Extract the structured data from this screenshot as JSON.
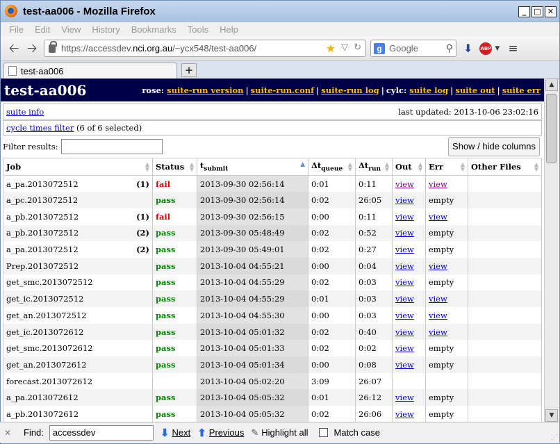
{
  "window": {
    "title": "test-aa006 - Mozilla Firefox",
    "controls": {
      "minimize": "_",
      "maximize": "□",
      "close": "✕"
    }
  },
  "menu": [
    "File",
    "Edit",
    "View",
    "History",
    "Bookmarks",
    "Tools",
    "Help"
  ],
  "nav": {
    "url_prefix": "https://accessdev.",
    "url_host": "nci.org.au",
    "url_path": "/~ycx548/test-aa006/",
    "search_placeholder": "Google",
    "search_engine_icon": "google-g-icon"
  },
  "tab": {
    "title": "test-aa006",
    "new_tab": "+"
  },
  "page": {
    "title": "test-aa006",
    "rose_label": "rose:",
    "rose_links": [
      "suite-run version",
      "suite-run.conf",
      "suite-run log"
    ],
    "cylc_label": "cylc:",
    "cylc_links": [
      "suite log",
      "suite out",
      "suite err"
    ],
    "suite_info": "suite info",
    "last_updated": "last updated: 2013-10-06 23:02:16",
    "cycle_filter_link": "cycle times filter",
    "cycle_filter_count": "(6 of 6 selected)",
    "filter_label": "Filter results:",
    "filter_value": "",
    "show_hide_button": "Show / hide columns"
  },
  "table": {
    "headers": {
      "job": "Job",
      "status": "Status",
      "tsubmit_main": "t",
      "tsubmit_sub": "submit",
      "tqueue_main": "Δt",
      "tqueue_sub": "queue",
      "trun_main": "Δt",
      "trun_sub": "run",
      "out": "Out",
      "err": "Err",
      "other": "Other Files"
    },
    "rows": [
      {
        "job": "a_pa.2013072512",
        "tries": "(1)",
        "status": "fail",
        "tsubmit": "2013-09-30 02:56:14",
        "tqueue": "0:01",
        "trun": "0:11",
        "out": "view",
        "err": "view",
        "visited": true
      },
      {
        "job": "a_pc.2013072512",
        "tries": "",
        "status": "pass",
        "tsubmit": "2013-09-30 02:56:14",
        "tqueue": "0:02",
        "trun": "26:05",
        "out": "view",
        "err": "empty"
      },
      {
        "job": "a_pb.2013072512",
        "tries": "(1)",
        "status": "fail",
        "tsubmit": "2013-09-30 02:56:15",
        "tqueue": "0:00",
        "trun": "0:11",
        "out": "view",
        "err": "view"
      },
      {
        "job": "a_pb.2013072512",
        "tries": "(2)",
        "status": "pass",
        "tsubmit": "2013-09-30 05:48:49",
        "tqueue": "0:02",
        "trun": "0:52",
        "out": "view",
        "err": "empty"
      },
      {
        "job": "a_pa.2013072512",
        "tries": "(2)",
        "status": "pass",
        "tsubmit": "2013-09-30 05:49:01",
        "tqueue": "0:02",
        "trun": "0:27",
        "out": "view",
        "err": "empty"
      },
      {
        "job": "Prep.2013072512",
        "tries": "",
        "status": "pass",
        "tsubmit": "2013-10-04 04:55:21",
        "tqueue": "0:00",
        "trun": "0:04",
        "out": "view",
        "err": "view"
      },
      {
        "job": "get_smc.2013072512",
        "tries": "",
        "status": "pass",
        "tsubmit": "2013-10-04 04:55:29",
        "tqueue": "0:02",
        "trun": "0:03",
        "out": "view",
        "err": "empty"
      },
      {
        "job": "get_ic.2013072512",
        "tries": "",
        "status": "pass",
        "tsubmit": "2013-10-04 04:55:29",
        "tqueue": "0:01",
        "trun": "0:03",
        "out": "view",
        "err": "view"
      },
      {
        "job": "get_an.2013072512",
        "tries": "",
        "status": "pass",
        "tsubmit": "2013-10-04 04:55:30",
        "tqueue": "0:00",
        "trun": "0:03",
        "out": "view",
        "err": "view"
      },
      {
        "job": "get_ic.2013072612",
        "tries": "",
        "status": "pass",
        "tsubmit": "2013-10-04 05:01:32",
        "tqueue": "0:02",
        "trun": "0:40",
        "out": "view",
        "err": "view"
      },
      {
        "job": "get_smc.2013072612",
        "tries": "",
        "status": "pass",
        "tsubmit": "2013-10-04 05:01:33",
        "tqueue": "0:02",
        "trun": "0:02",
        "out": "view",
        "err": "empty"
      },
      {
        "job": "get_an.2013072612",
        "tries": "",
        "status": "pass",
        "tsubmit": "2013-10-04 05:01:34",
        "tqueue": "0:00",
        "trun": "0:08",
        "out": "view",
        "err": "empty"
      },
      {
        "job": "forecast.2013072612",
        "tries": "",
        "status": "",
        "tsubmit": "2013-10-04 05:02:20",
        "tqueue": "3:09",
        "trun": "26:07",
        "out": "",
        "err": ""
      },
      {
        "job": "a_pa.2013072612",
        "tries": "",
        "status": "pass",
        "tsubmit": "2013-10-04 05:05:32",
        "tqueue": "0:01",
        "trun": "26:12",
        "out": "view",
        "err": "empty"
      },
      {
        "job": "a_pb.2013072612",
        "tries": "",
        "status": "pass",
        "tsubmit": "2013-10-04 05:05:32",
        "tqueue": "0:02",
        "trun": "26:06",
        "out": "view",
        "err": "empty"
      }
    ]
  },
  "findbar": {
    "close": "✕",
    "label": "Find:",
    "value": "accessdev",
    "next": "Next",
    "previous": "Previous",
    "highlight": "Highlight all",
    "match_case": "Match case"
  }
}
